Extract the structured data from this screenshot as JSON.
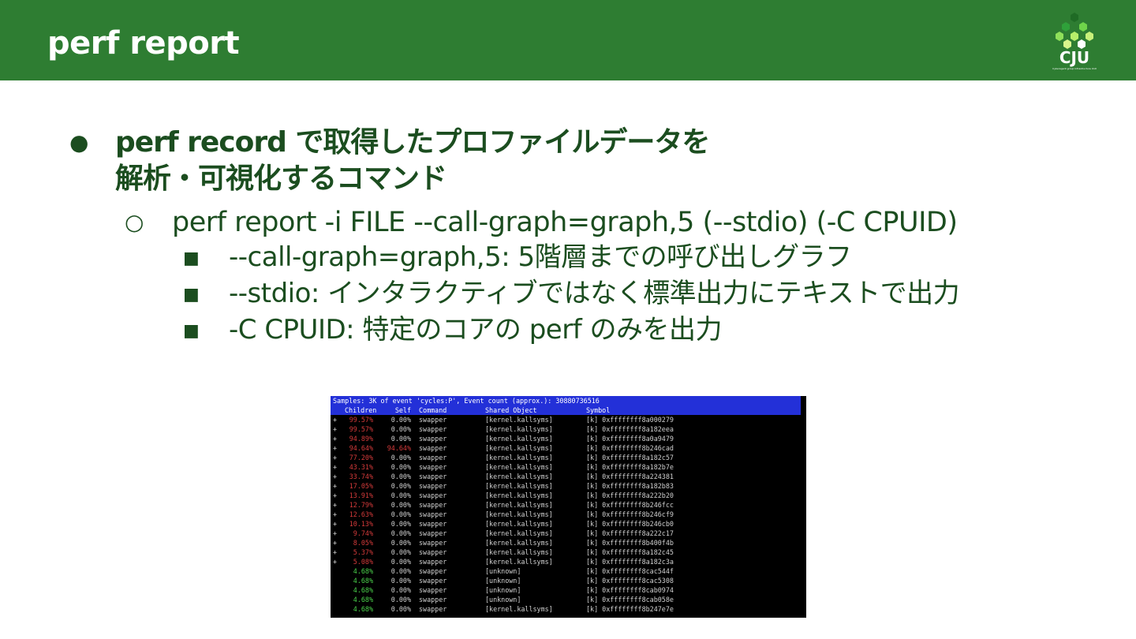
{
  "header": {
    "title": "perf report",
    "logo_text": "CJU",
    "logo_subtext": "Cyberagent group Infrastructure Unit"
  },
  "colors": {
    "header_bg": "#2e7d32",
    "text": "#1b4d1f",
    "terminal_bar": "#2330d8",
    "red": "#d43a3a",
    "green": "#4bd24b"
  },
  "bullets": {
    "level1_marker": "●",
    "level2_marker": "○",
    "level3_marker": "■",
    "main_line1": "perf record で取得したプロファイルデータを",
    "main_line2": "解析・可視化するコマンド",
    "command": "perf report -i FILE --call-graph=graph,5 (--stdio) (-C CPUID)",
    "options": [
      "--call-graph=graph,5: 5階層までの呼び出しグラフ",
      "--stdio: インタラクティブではなく標準出力にテキストで出力",
      "-C CPUID: 特定のコアの perf のみを出力"
    ]
  },
  "terminal": {
    "summary": "Samples: 3K of event 'cycles:P', Event count (approx.): 30880736516",
    "columns": [
      "Children",
      "Self",
      "Command",
      "Shared Object",
      "Symbol"
    ],
    "rows": [
      {
        "plus": "+",
        "children": "99.57%",
        "self": "0.00%",
        "command": "swapper",
        "object": "[kernel.kallsyms]",
        "symbol": "[k] 0xffffffff8a000279",
        "color": "red"
      },
      {
        "plus": "+",
        "children": "99.57%",
        "self": "0.00%",
        "command": "swapper",
        "object": "[kernel.kallsyms]",
        "symbol": "[k] 0xffffffff8a182eea",
        "color": "red"
      },
      {
        "plus": "+",
        "children": "94.89%",
        "self": "0.00%",
        "command": "swapper",
        "object": "[kernel.kallsyms]",
        "symbol": "[k] 0xffffffff8a0a9479",
        "color": "red"
      },
      {
        "plus": "+",
        "children": "94.64%",
        "self": "94.64%",
        "command": "swapper",
        "object": "[kernel.kallsyms]",
        "symbol": "[k] 0xffffffff8b246cad",
        "color": "red"
      },
      {
        "plus": "+",
        "children": "77.20%",
        "self": "0.00%",
        "command": "swapper",
        "object": "[kernel.kallsyms]",
        "symbol": "[k] 0xffffffff8a182c57",
        "color": "red"
      },
      {
        "plus": "+",
        "children": "43.31%",
        "self": "0.00%",
        "command": "swapper",
        "object": "[kernel.kallsyms]",
        "symbol": "[k] 0xffffffff8a182b7e",
        "color": "red"
      },
      {
        "plus": "+",
        "children": "33.74%",
        "self": "0.00%",
        "command": "swapper",
        "object": "[kernel.kallsyms]",
        "symbol": "[k] 0xffffffff8a224381",
        "color": "red"
      },
      {
        "plus": "+",
        "children": "17.05%",
        "self": "0.00%",
        "command": "swapper",
        "object": "[kernel.kallsyms]",
        "symbol": "[k] 0xffffffff8a182b83",
        "color": "red"
      },
      {
        "plus": "+",
        "children": "13.91%",
        "self": "0.00%",
        "command": "swapper",
        "object": "[kernel.kallsyms]",
        "symbol": "[k] 0xffffffff8a222b20",
        "color": "red"
      },
      {
        "plus": "+",
        "children": "12.79%",
        "self": "0.00%",
        "command": "swapper",
        "object": "[kernel.kallsyms]",
        "symbol": "[k] 0xffffffff8b246fcc",
        "color": "red"
      },
      {
        "plus": "+",
        "children": "12.63%",
        "self": "0.00%",
        "command": "swapper",
        "object": "[kernel.kallsyms]",
        "symbol": "[k] 0xffffffff8b246cf9",
        "color": "red"
      },
      {
        "plus": "+",
        "children": "10.13%",
        "self": "0.00%",
        "command": "swapper",
        "object": "[kernel.kallsyms]",
        "symbol": "[k] 0xffffffff8b246cb0",
        "color": "red"
      },
      {
        "plus": "+",
        "children": "9.74%",
        "self": "0.00%",
        "command": "swapper",
        "object": "[kernel.kallsyms]",
        "symbol": "[k] 0xffffffff8a222c17",
        "color": "red"
      },
      {
        "plus": "+",
        "children": "8.05%",
        "self": "0.00%",
        "command": "swapper",
        "object": "[kernel.kallsyms]",
        "symbol": "[k] 0xffffffff8b400f4b",
        "color": "red"
      },
      {
        "plus": "+",
        "children": "5.37%",
        "self": "0.00%",
        "command": "swapper",
        "object": "[kernel.kallsyms]",
        "symbol": "[k] 0xffffffff8a182c45",
        "color": "red"
      },
      {
        "plus": "+",
        "children": "5.08%",
        "self": "0.00%",
        "command": "swapper",
        "object": "[kernel.kallsyms]",
        "symbol": "[k] 0xffffffff8a182c3a",
        "color": "red"
      },
      {
        "plus": "",
        "children": "4.68%",
        "self": "0.00%",
        "command": "swapper",
        "object": "[unknown]",
        "symbol": "[k] 0xffffffff8cac544f",
        "color": "green"
      },
      {
        "plus": "",
        "children": "4.68%",
        "self": "0.00%",
        "command": "swapper",
        "object": "[unknown]",
        "symbol": "[k] 0xffffffff8cac5308",
        "color": "green"
      },
      {
        "plus": "",
        "children": "4.68%",
        "self": "0.00%",
        "command": "swapper",
        "object": "[unknown]",
        "symbol": "[k] 0xffffffff8cab0974",
        "color": "green"
      },
      {
        "plus": "",
        "children": "4.68%",
        "self": "0.00%",
        "command": "swapper",
        "object": "[unknown]",
        "symbol": "[k] 0xffffffff8cab058e",
        "color": "green"
      },
      {
        "plus": "",
        "children": "4.68%",
        "self": "0.00%",
        "command": "swapper",
        "object": "[kernel.kallsyms]",
        "symbol": "[k] 0xffffffff8b247e7e",
        "color": "green"
      }
    ]
  }
}
